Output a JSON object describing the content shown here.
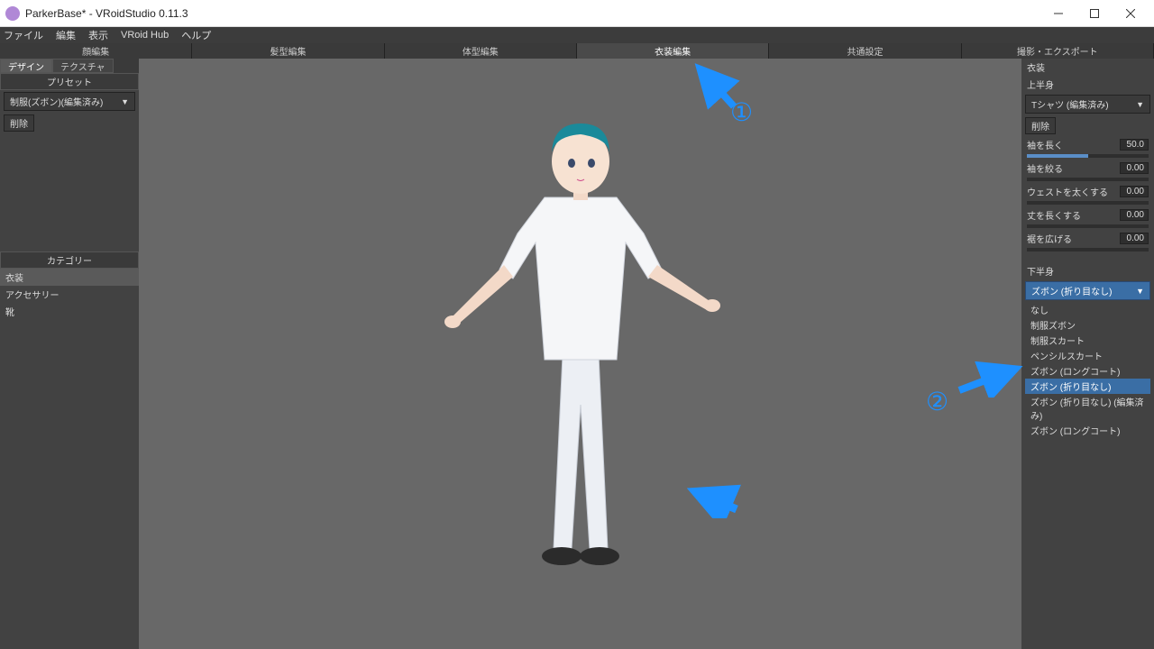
{
  "window": {
    "title": "ParkerBase* - VRoidStudio 0.11.3"
  },
  "menu": {
    "file": "ファイル",
    "edit": "編集",
    "view": "表示",
    "vroid_hub": "VRoid Hub",
    "help": "ヘルプ"
  },
  "main_tabs": [
    {
      "label": "顔編集"
    },
    {
      "label": "髪型編集"
    },
    {
      "label": "体型編集"
    },
    {
      "label": "衣装編集",
      "active": true
    },
    {
      "label": "共通設定"
    },
    {
      "label": "撮影・エクスポート"
    }
  ],
  "left": {
    "sub_tabs": [
      {
        "label": "デザイン",
        "active": true
      },
      {
        "label": "テクスチャ"
      }
    ],
    "preset_header": "プリセット",
    "preset_select": "制服(ズボン)(編集済み)",
    "delete_btn": "削除",
    "category_header": "カテゴリー",
    "category_items": [
      "衣装",
      "アクセサリー",
      "靴"
    ],
    "category_selected": 0
  },
  "right": {
    "header": "衣装",
    "upper_label": "上半身",
    "upper_select": "Tシャツ (編集済み)",
    "delete_btn": "削除",
    "sliders_upper": [
      {
        "label": "袖を長く",
        "value": "50.0",
        "fill": 50
      },
      {
        "label": "袖を絞る",
        "value": "0.00",
        "fill": 0
      },
      {
        "label": "ウェストを太くする",
        "value": "0.00",
        "fill": 0
      },
      {
        "label": "丈を長くする",
        "value": "0.00",
        "fill": 0
      },
      {
        "label": "裾を広げる",
        "value": "0.00",
        "fill": 0
      }
    ],
    "lower_label": "下半身",
    "lower_select": "ズボン (折り目なし)",
    "lower_options": [
      "なし",
      "制服ズボン",
      "制服スカート",
      "ペンシルスカート",
      "ズボン (ロングコート)",
      "ズボン (折り目なし)",
      "ズボン (折り目なし) (編集済み)",
      "ズボン (ロングコート)"
    ],
    "lower_selected_index": 5
  },
  "annotations": {
    "num1": "①",
    "num2": "②"
  }
}
